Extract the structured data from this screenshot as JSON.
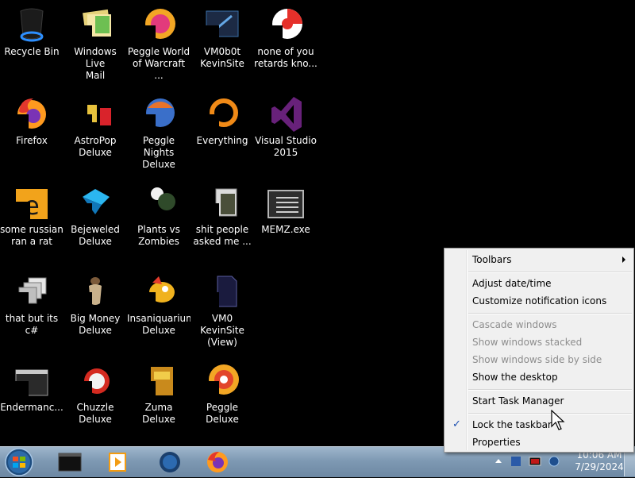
{
  "desktop": {
    "icons": [
      {
        "label": "Recycle Bin",
        "icon": "recycle-bin-icon"
      },
      {
        "label": "Windows Live\nMail",
        "icon": "windows-live-mail-icon"
      },
      {
        "label": "Peggle World\nof Warcraft ...",
        "icon": "peggle-world-icon"
      },
      {
        "label": "VM0b0t\nKevinSite",
        "icon": "vm0b0t-icon"
      },
      {
        "label": "none of you\nretards kno...",
        "icon": "chrome-like-icon"
      },
      {
        "label": "Firefox",
        "icon": "firefox-icon"
      },
      {
        "label": "AstroPop\nDeluxe",
        "icon": "astropop-icon"
      },
      {
        "label": "Peggle Nights\nDeluxe",
        "icon": "peggle-nights-icon"
      },
      {
        "label": "Everything",
        "icon": "everything-icon"
      },
      {
        "label": "Visual Studio\n2015",
        "icon": "visual-studio-icon"
      },
      {
        "label": "some russian\nran a rat",
        "icon": "internet-explorer-icon"
      },
      {
        "label": "Bejeweled\nDeluxe",
        "icon": "bejeweled-icon"
      },
      {
        "label": "Plants vs\nZombies",
        "icon": "plants-vs-zombies-icon"
      },
      {
        "label": "shit people\nasked me ...",
        "icon": "folder-icon"
      },
      {
        "label": "MEMZ.exe",
        "icon": "exe-window-icon"
      },
      {
        "label": "that but its c#",
        "icon": "windows-shortcut-icon"
      },
      {
        "label": "Big Money\nDeluxe",
        "icon": "big-money-icon"
      },
      {
        "label": "Insaniquarium\nDeluxe",
        "icon": "insaniquarium-icon"
      },
      {
        "label": "VM0 KevinSite\n(View)",
        "icon": "vm0-kevinsite-icon"
      },
      {
        "label": "Endermanc...",
        "icon": "console-window-icon"
      },
      {
        "label": "Chuzzle\nDeluxe",
        "icon": "chuzzle-icon"
      },
      {
        "label": "Zuma Deluxe",
        "icon": "zuma-icon"
      },
      {
        "label": "Peggle Deluxe",
        "icon": "peggle-deluxe-icon"
      }
    ]
  },
  "context_menu": {
    "items": [
      {
        "label": "Toolbars",
        "submenu": true,
        "enabled": true
      },
      {
        "label": "Adjust date/time",
        "enabled": true
      },
      {
        "label": "Customize notification icons",
        "enabled": true
      },
      {
        "label": "Cascade windows",
        "enabled": false
      },
      {
        "label": "Show windows stacked",
        "enabled": false
      },
      {
        "label": "Show windows side by side",
        "enabled": false
      },
      {
        "label": "Show the desktop",
        "enabled": true
      },
      {
        "label": "Start Task Manager",
        "enabled": true
      },
      {
        "label": "Lock the taskbar",
        "enabled": true,
        "checked": true
      },
      {
        "label": "Properties",
        "enabled": true
      }
    ],
    "check_glyph": "✓"
  },
  "taskbar": {
    "start": {
      "icon": "windows-start-orb-icon"
    },
    "pinned": [
      {
        "icon": "terminal-app-icon"
      },
      {
        "icon": "media-player-icon"
      },
      {
        "icon": "globe-app-icon"
      },
      {
        "icon": "firefox-icon"
      }
    ],
    "tray": {
      "time": "10:06 AM",
      "date": "7/29/2024",
      "icons": [
        "show-hidden-icons-icon",
        "monitor-app-icon",
        "red-window-icon",
        "network-icon"
      ]
    }
  },
  "colors": {
    "menu_bg": "#f0f0f0",
    "disabled_text": "#8d8d8d",
    "taskbar_top": "#9fb6cc",
    "taskbar_bottom": "#6d88a3"
  }
}
